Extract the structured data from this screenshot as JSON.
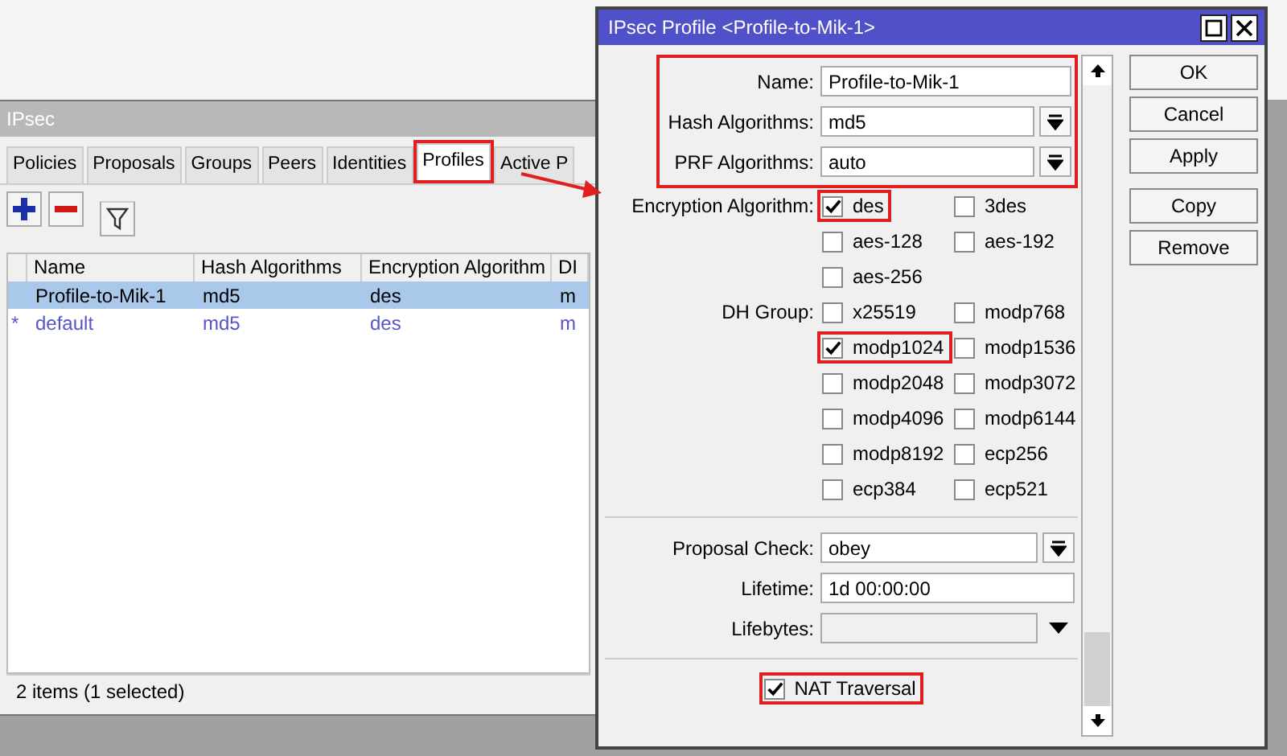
{
  "main_window": {
    "title": "IPsec",
    "tabs": [
      {
        "label": "Policies",
        "selected": false,
        "highlighted": false
      },
      {
        "label": "Proposals",
        "selected": false,
        "highlighted": false
      },
      {
        "label": "Groups",
        "selected": false,
        "highlighted": false
      },
      {
        "label": "Peers",
        "selected": false,
        "highlighted": false
      },
      {
        "label": "Identities",
        "selected": false,
        "highlighted": false
      },
      {
        "label": "Profiles",
        "selected": true,
        "highlighted": true
      },
      {
        "label": "Active P",
        "selected": false,
        "highlighted": false
      }
    ],
    "table": {
      "columns": [
        "Name",
        "Hash Algorithms",
        "Encryption Algorithm",
        "DI"
      ],
      "rows": [
        {
          "marker": "",
          "dynamic": false,
          "selected": true,
          "cells": [
            "Profile-to-Mik-1",
            "md5",
            "des",
            "m"
          ]
        },
        {
          "marker": "*",
          "dynamic": true,
          "selected": false,
          "cells": [
            "default",
            "md5",
            "des",
            "m"
          ]
        }
      ]
    },
    "status_bar": "2 items (1 selected)"
  },
  "annotation_arrow": true,
  "dialog": {
    "title": "IPsec Profile <Profile-to-Mik-1>",
    "top_fields": {
      "highlighted": true,
      "rows": [
        {
          "kind": "text",
          "label": "Name:",
          "value": "Profile-to-Mik-1"
        },
        {
          "kind": "dropdown",
          "label": "Hash Algorithms:",
          "value": "md5"
        },
        {
          "kind": "dropdown",
          "label": "PRF Algorithms:",
          "value": "auto"
        }
      ]
    },
    "rows": [
      {
        "kind": "checks",
        "label": "Encryption Algorithm:",
        "options": [
          {
            "label": "des",
            "checked": true,
            "highlighted": true
          },
          {
            "label": "3des",
            "checked": false,
            "highlighted": false
          },
          {
            "label": "aes-128",
            "checked": false,
            "highlighted": false
          },
          {
            "label": "aes-192",
            "checked": false,
            "highlighted": false
          },
          {
            "label": "aes-256",
            "checked": false,
            "highlighted": false
          }
        ]
      },
      {
        "kind": "checks",
        "label": "DH Group:",
        "options": [
          {
            "label": "x25519",
            "checked": false,
            "highlighted": false
          },
          {
            "label": "modp768",
            "checked": false,
            "highlighted": false
          },
          {
            "label": "modp1024",
            "checked": true,
            "highlighted": true
          },
          {
            "label": "modp1536",
            "checked": false,
            "highlighted": false
          },
          {
            "label": "modp2048",
            "checked": false,
            "highlighted": false
          },
          {
            "label": "modp3072",
            "checked": false,
            "highlighted": false
          },
          {
            "label": "modp4096",
            "checked": false,
            "highlighted": false
          },
          {
            "label": "modp6144",
            "checked": false,
            "highlighted": false
          },
          {
            "label": "modp8192",
            "checked": false,
            "highlighted": false
          },
          {
            "label": "ecp256",
            "checked": false,
            "highlighted": false
          },
          {
            "label": "ecp384",
            "checked": false,
            "highlighted": false
          },
          {
            "label": "ecp521",
            "checked": false,
            "highlighted": false
          }
        ]
      },
      {
        "kind": "separator"
      },
      {
        "kind": "dropdown",
        "label": "Proposal Check:",
        "value": "obey"
      },
      {
        "kind": "text",
        "label": "Lifetime:",
        "value": "1d 00:00:00"
      },
      {
        "kind": "combo",
        "label": "Lifebytes:"
      },
      {
        "kind": "separator"
      },
      {
        "kind": "check",
        "label": "NAT Traversal",
        "checked": true,
        "highlighted": true
      }
    ],
    "button_groups": [
      [
        "OK",
        "Cancel",
        "Apply"
      ],
      [
        "Copy",
        "Remove"
      ]
    ]
  }
}
